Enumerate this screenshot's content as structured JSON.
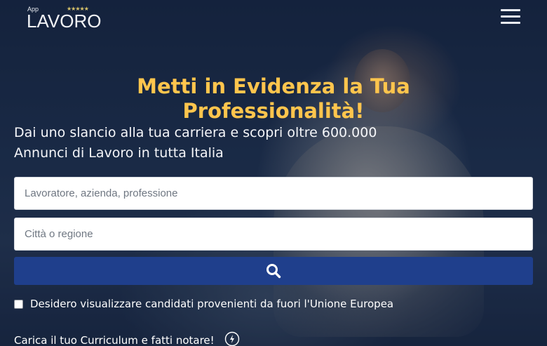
{
  "header": {
    "logo_app": "App",
    "logo_brand": "LAVORO",
    "logo_stars": "★★★★★"
  },
  "hero": {
    "title": "Metti in Evidenza la Tua Professionalità!",
    "subtitle": "Dai uno slancio alla tua carriera e scopri oltre 600.000 Annunci di Lavoro in tutta Italia"
  },
  "search": {
    "query_placeholder": "Lavoratore, azienda, professione",
    "query_value": "",
    "location_placeholder": "Città o regione",
    "location_value": ""
  },
  "options": {
    "non_eu_label": "Desidero visualizzare candidati provenienti da fuori l'Unione Europea",
    "non_eu_checked": false
  },
  "cta": {
    "upload_cv_label": "Carica il tuo Curriculum e fatti notare!"
  },
  "colors": {
    "title": "#ffc54d",
    "search_button": "#1f3f8c"
  }
}
